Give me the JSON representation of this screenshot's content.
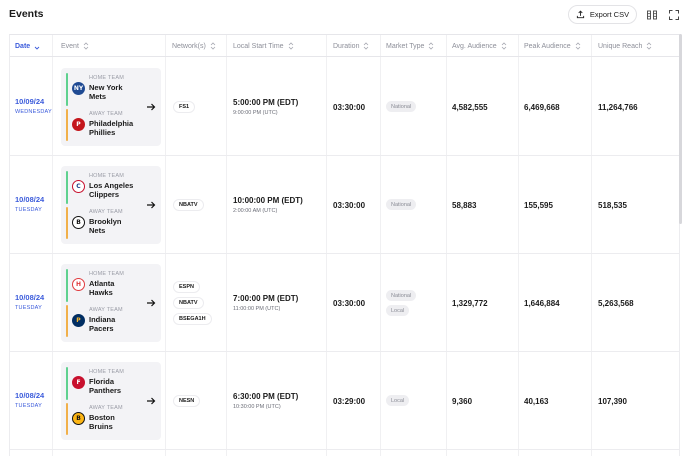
{
  "header": {
    "title": "Events",
    "export_label": "Export CSV",
    "columns_icon": "columns-icon",
    "fullscreen_icon": "fullscreen-icon"
  },
  "columns": [
    "Date",
    "Event",
    "Network(s)",
    "Local Start Time",
    "Duration",
    "Market Type",
    "Avg. Audience",
    "Peak Audience",
    "Unique Reach"
  ],
  "colors": {
    "accent": "#3b5bdb",
    "home_bar": "#5fd18f",
    "away_bar": "#f1b04a"
  },
  "labels": {
    "home_team": "HOME TEAM",
    "away_team": "AWAY TEAM"
  },
  "rows": [
    {
      "date": "10/09/24",
      "weekday": "WEDNESDAY",
      "home": {
        "name_1": "New York",
        "name_2": "Mets",
        "logo": "mets-logo",
        "color": "#1f4a93"
      },
      "away": {
        "name_1": "Philadelphia",
        "name_2": "Phillies",
        "logo": "phillies-logo",
        "color": "#c4161c"
      },
      "networks": [
        "FS1"
      ],
      "time": "5:00:00 PM (EDT)",
      "time_utc": "9:00:00 PM (UTC)",
      "duration": "03:30:00",
      "market": [
        "National"
      ],
      "avg": "4,582,555",
      "peak": "6,469,668",
      "reach": "11,264,766"
    },
    {
      "date": "10/08/24",
      "weekday": "TUESDAY",
      "home": {
        "name_1": "Los Angeles",
        "name_2": "Clippers",
        "logo": "clippers-logo",
        "color": "#c8102e"
      },
      "away": {
        "name_1": "Brooklyn",
        "name_2": "Nets",
        "logo": "nets-logo",
        "color": "#111111"
      },
      "networks": [
        "NBATV"
      ],
      "time": "10:00:00 PM (EDT)",
      "time_utc": "2:00:00 AM (UTC)",
      "duration": "03:30:00",
      "market": [
        "National"
      ],
      "avg": "58,883",
      "peak": "155,595",
      "reach": "518,535"
    },
    {
      "date": "10/08/24",
      "weekday": "TUESDAY",
      "home": {
        "name_1": "Atlanta",
        "name_2": "Hawks",
        "logo": "hawks-logo",
        "color": "#e03a3e"
      },
      "away": {
        "name_1": "Indiana",
        "name_2": "Pacers",
        "logo": "pacers-logo",
        "color": "#002d62"
      },
      "networks": [
        "ESPN",
        "NBATV",
        "BSEGA1H"
      ],
      "time": "7:00:00 PM (EDT)",
      "time_utc": "11:00:00 PM (UTC)",
      "duration": "03:30:00",
      "market": [
        "National",
        "Local"
      ],
      "avg": "1,329,772",
      "peak": "1,646,884",
      "reach": "5,263,568"
    },
    {
      "date": "10/08/24",
      "weekday": "TUESDAY",
      "home": {
        "name_1": "Florida",
        "name_2": "Panthers",
        "logo": "panthers-logo",
        "color": "#c8102e"
      },
      "away": {
        "name_1": "Boston",
        "name_2": "Bruins",
        "logo": "bruins-logo",
        "color": "#111111"
      },
      "networks": [
        "NESN"
      ],
      "time": "6:30:00 PM (EDT)",
      "time_utc": "10:30:00 PM (UTC)",
      "duration": "03:29:00",
      "market": [
        "Local"
      ],
      "avg": "9,360",
      "peak": "40,163",
      "reach": "107,390"
    }
  ]
}
